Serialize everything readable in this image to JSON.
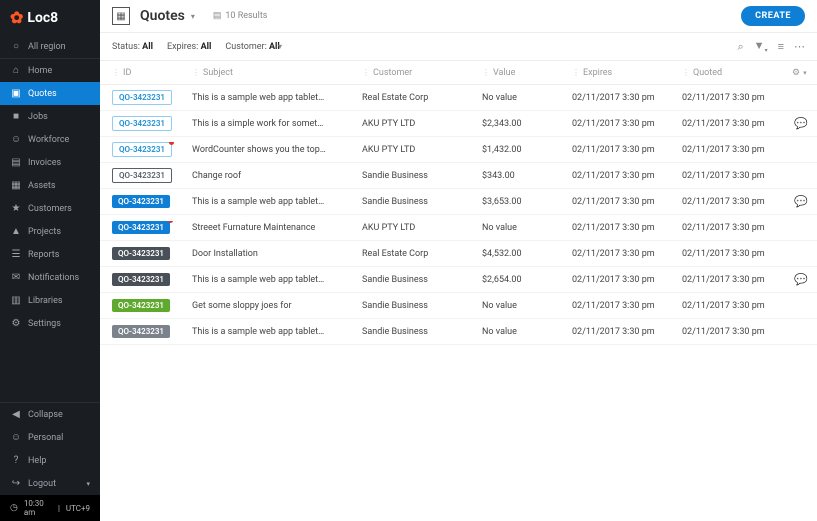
{
  "brand": "Loc8",
  "region": "All region",
  "status": {
    "time": "10:30 am",
    "tz": "UTC+9"
  },
  "nav": [
    {
      "label": "Home",
      "icon": "⌂"
    },
    {
      "label": "Quotes",
      "icon": "▣",
      "active": true
    },
    {
      "label": "Jobs",
      "icon": "■"
    },
    {
      "label": "Workforce",
      "icon": "☺"
    },
    {
      "label": "Invoices",
      "icon": "▤"
    },
    {
      "label": "Assets",
      "icon": "▦"
    },
    {
      "label": "Customers",
      "icon": "★"
    },
    {
      "label": "Projects",
      "icon": "▲"
    },
    {
      "label": "Reports",
      "icon": "☰"
    },
    {
      "label": "Notifications",
      "icon": "✉"
    },
    {
      "label": "Libraries",
      "icon": "▥"
    },
    {
      "label": "Settings",
      "icon": "⚙"
    }
  ],
  "nav_bottom": [
    {
      "label": "Collapse",
      "icon": "◀"
    },
    {
      "label": "Personal",
      "icon": "☺"
    },
    {
      "label": "Help",
      "icon": "?"
    },
    {
      "label": "Logout",
      "icon": "↪"
    }
  ],
  "header": {
    "title": "Quotes",
    "results": "10 Results",
    "create": "CREATE"
  },
  "filters": {
    "status": {
      "label": "Status: ",
      "value": "All"
    },
    "expires": {
      "label": "Expires: ",
      "value": "All"
    },
    "customer": {
      "label": "Customer: ",
      "value": "All"
    }
  },
  "columns": [
    "ID",
    "Subject",
    "Customer",
    "Value",
    "Expires",
    "Quoted"
  ],
  "rows": [
    {
      "id": "QO-3423231",
      "badge": "b-outline-light",
      "dot": false,
      "subject": "This is a sample web app tablet…",
      "customer": "Real Estate Corp",
      "value": "No value",
      "expires": "02/11/2017 3:30 pm",
      "quoted": "02/11/2017 3:30 pm",
      "chat": false
    },
    {
      "id": "QO-3423231",
      "badge": "b-outline-light",
      "dot": false,
      "subject": "This is a simple work for somet…",
      "customer": "AKU PTY LTD",
      "value": "$2,343.00",
      "expires": "02/11/2017 3:30 pm",
      "quoted": "02/11/2017 3:30 pm",
      "chat": true
    },
    {
      "id": "QO-3423231",
      "badge": "b-outline-light",
      "dot": true,
      "subject": "WordCounter shows you the top…",
      "customer": "AKU PTY LTD",
      "value": "$1,432.00",
      "expires": "02/11/2017 3:30 pm",
      "quoted": "02/11/2017 3:30 pm",
      "chat": false
    },
    {
      "id": "QO-3423231",
      "badge": "b-outline-dark",
      "dot": false,
      "subject": "Change roof",
      "customer": "Sandie Business",
      "value": "$343.00",
      "expires": "02/11/2017 3:30 pm",
      "quoted": "02/11/2017 3:30 pm",
      "chat": false
    },
    {
      "id": "QO-3423231",
      "badge": "b-blue",
      "dot": false,
      "subject": "This is a sample web app tablet…",
      "customer": "Sandie Business",
      "value": "$3,653.00",
      "expires": "02/11/2017 3:30 pm",
      "quoted": "02/11/2017 3:30 pm",
      "chat": true
    },
    {
      "id": "QO-3423231",
      "badge": "b-blue",
      "dot": true,
      "subject": "Streeet Furnature Maintenance",
      "customer": "AKU PTY LTD",
      "value": "No value",
      "expires": "02/11/2017 3:30 pm",
      "quoted": "02/11/2017 3:30 pm",
      "chat": false
    },
    {
      "id": "QO-3423231",
      "badge": "b-dark",
      "dot": false,
      "subject": "Door Installation",
      "customer": "Real Estate Corp",
      "value": "$4,532.00",
      "expires": "02/11/2017 3:30 pm",
      "quoted": "02/11/2017 3:30 pm",
      "chat": false
    },
    {
      "id": "QO-3423231",
      "badge": "b-dark",
      "dot": false,
      "subject": "This is a sample web app tablet…",
      "customer": "Sandie Business",
      "value": "$2,654.00",
      "expires": "02/11/2017 3:30 pm",
      "quoted": "02/11/2017 3:30 pm",
      "chat": true
    },
    {
      "id": "QO-3423231",
      "badge": "b-green",
      "dot": false,
      "subject": "Get some sloppy joes for",
      "customer": "Sandie Business",
      "value": "No value",
      "expires": "02/11/2017 3:30 pm",
      "quoted": "02/11/2017 3:30 pm",
      "chat": false
    },
    {
      "id": "QO-3423231",
      "badge": "b-gray",
      "dot": false,
      "subject": "This is a sample web app tablet…",
      "customer": "Sandie Business",
      "value": "No value",
      "expires": "02/11/2017 3:30 pm",
      "quoted": "02/11/2017 3:30 pm",
      "chat": false
    }
  ]
}
